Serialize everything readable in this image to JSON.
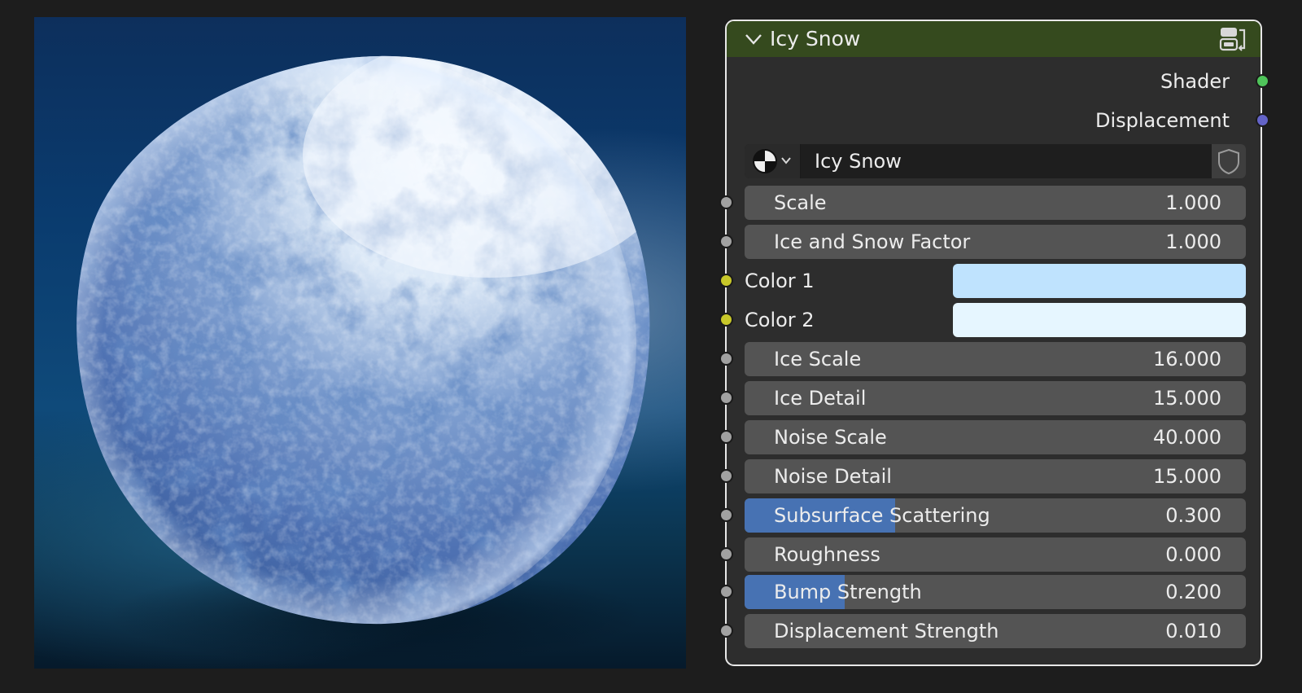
{
  "node": {
    "title": "Icy Snow",
    "header_color": "#354a1e",
    "outputs": [
      {
        "label": "Shader",
        "socket_color": "#4fc45a"
      },
      {
        "label": "Displacement",
        "socket_color": "#6363c7"
      }
    ],
    "material": {
      "name": "Icy Snow",
      "type_icon": "material-sphere-icon",
      "fake_user_icon": "shield-icon"
    },
    "inputs": {
      "scale": {
        "label": "Scale",
        "value": "1.000"
      },
      "ice_snow_factor": {
        "label": "Ice and Snow Factor",
        "value": "1.000"
      },
      "color1": {
        "label": "Color 1",
        "color": "#bfe3fe"
      },
      "color2": {
        "label": "Color 2",
        "color": "#e6f6ff"
      },
      "ice_scale": {
        "label": "Ice Scale",
        "value": "16.000"
      },
      "ice_detail": {
        "label": "Ice Detail",
        "value": "15.000"
      },
      "noise_scale": {
        "label": "Noise Scale",
        "value": "40.000"
      },
      "noise_detail": {
        "label": "Noise Detail",
        "value": "15.000"
      },
      "subsurface": {
        "label": "Subsurface Scattering",
        "value": "0.300",
        "fraction": 0.3
      },
      "roughness": {
        "label": "Roughness",
        "value": "0.000",
        "fraction": 0
      },
      "bump": {
        "label": "Bump Strength",
        "value": "0.200",
        "fraction": 0.2
      },
      "displacement_strength": {
        "label": "Displacement Strength",
        "value": "0.010"
      }
    }
  },
  "preview": {
    "subject": "snow-sphere-render"
  },
  "colors": {
    "value_socket": "#a1a1a1",
    "color_socket": "#c7c729",
    "slider_fill": "#4772b3"
  }
}
